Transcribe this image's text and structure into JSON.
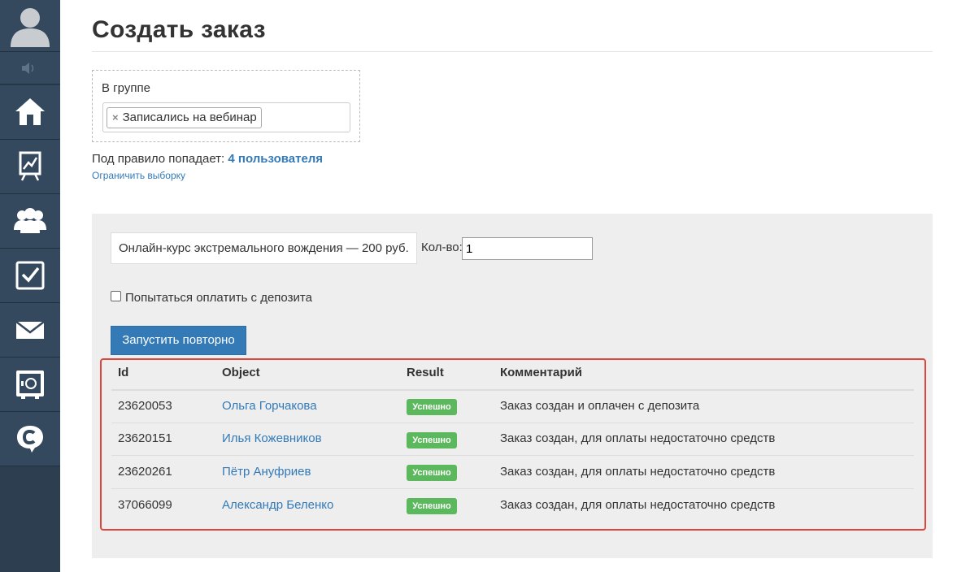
{
  "page": {
    "title": "Создать заказ"
  },
  "sidebar": {
    "items": [
      {
        "icon": "home-icon"
      },
      {
        "icon": "chart-icon"
      },
      {
        "icon": "users-icon"
      },
      {
        "icon": "tasks-icon"
      },
      {
        "icon": "mail-icon"
      },
      {
        "icon": "safe-icon"
      },
      {
        "icon": "chat-icon"
      }
    ]
  },
  "filter": {
    "group_label": "В группе",
    "tag_remove": "×",
    "tag": "Записались на вебинар",
    "rule_prefix": "Под правило попадает: ",
    "rule_count": "4 пользователя",
    "limit_link": "Ограничить выборку"
  },
  "order": {
    "product": "Онлайн-курс экстремального вождения — 200 руб.",
    "qty_label": "Кол-во:",
    "qty_value": "1",
    "deposit_label": "Попытаться оплатить с депозита",
    "deposit_checked": false,
    "rerun_button": "Запустить повторно"
  },
  "results": {
    "columns": [
      "Id",
      "Object",
      "Result",
      "Комментарий"
    ],
    "rows": [
      {
        "id": "23620053",
        "object": "Ольга Горчакова",
        "result": "Успешно",
        "comment": "Заказ создан и оплачен с депозита"
      },
      {
        "id": "23620151",
        "object": "Илья Кожевников",
        "result": "Успешно",
        "comment": "Заказ создан, для оплаты недостаточно средств"
      },
      {
        "id": "23620261",
        "object": "Пётр Ануфриев",
        "result": "Успешно",
        "comment": "Заказ создан, для оплаты недостаточно средств"
      },
      {
        "id": "37066099",
        "object": "Александр Беленко",
        "result": "Успешно",
        "comment": "Заказ создан, для оплаты недостаточно средств"
      }
    ]
  },
  "colors": {
    "sidebar": "#34495e",
    "link": "#337ab7",
    "success": "#5cb85c",
    "highlight": "#e0453a",
    "panel": "#eeeeee"
  }
}
